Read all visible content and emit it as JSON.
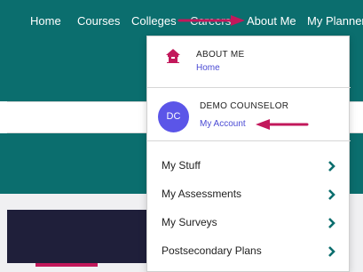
{
  "nav": {
    "home": "Home",
    "courses": "Courses",
    "colleges": "Colleges",
    "careers": "Careers",
    "about": "About Me",
    "planner": "My Planner"
  },
  "dropdown": {
    "about_title": "ABOUT ME",
    "about_link": "Home",
    "avatar_initials": "DC",
    "user_name": "DEMO COUNSELOR",
    "user_link": "My Account",
    "items": [
      {
        "label": "My Stuff"
      },
      {
        "label": "My Assessments"
      },
      {
        "label": "My Surveys"
      },
      {
        "label": "Postsecondary Plans"
      }
    ]
  },
  "colors": {
    "teal": "#0b6e6e",
    "accent_arrow": "#c2185b",
    "avatar": "#5b55e8",
    "link": "#4a4ad4"
  },
  "icons": {
    "home": "home-icon",
    "chevron": "chevron-right-icon",
    "annotation": "arrow-icon"
  }
}
